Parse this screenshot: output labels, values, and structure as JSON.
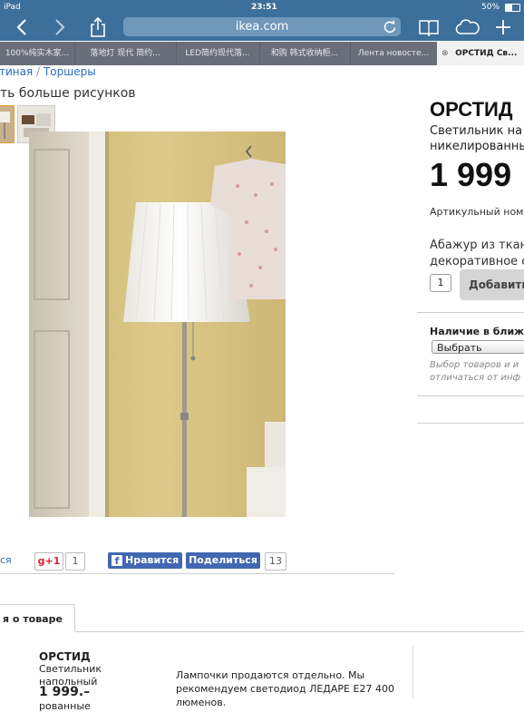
{
  "status_bar": {
    "device": "iPad",
    "time": "23:51",
    "battery": "50%"
  },
  "browser": {
    "url": "ikea.com"
  },
  "tabs": [
    {
      "label": "100%纯实木家..."
    },
    {
      "label": "落地灯 现代 简约..."
    },
    {
      "label": "LED简约现代落..."
    },
    {
      "label": "和购 韩式收纳柜..."
    },
    {
      "label": "Лента новосте..."
    },
    {
      "label": "ОРСТИД Св..."
    }
  ],
  "breadcrumb": {
    "part1": "тиная",
    "separator": "/",
    "part2": "Торшеры"
  },
  "gallery": {
    "more_images": "ть больше рисунков"
  },
  "social": {
    "left_link": "ся",
    "gplus_label": "g+1",
    "gplus_count": "1",
    "like_label": "Нравится",
    "share_label": "Поделиться",
    "share_count": "13"
  },
  "product": {
    "name": "ОРСТИД",
    "desc_line1": "Светильник на",
    "desc_line2": "никелированны",
    "price": "1 999",
    "article_label": "Артикульный номе",
    "shade_line1": "Абажур из ткан",
    "shade_line2": "декоративное с",
    "quantity": "1",
    "add_button": "Добавить"
  },
  "availability": {
    "title": "Наличие в ближа",
    "select_value": "Выбрать",
    "note_line1": "Выбор товаров и и",
    "note_line2": "отличаться от инф"
  },
  "info_tab": {
    "label": "я о товаре"
  },
  "bottom": {
    "name": "ОРСТИД",
    "desc_line1": "Светильник",
    "desc_line2": "напольный",
    "price": "1 999.–",
    "cut_text": "рованные",
    "note_line1": "Лампочки продаются отдельно. Мы",
    "note_line2": "рекомендуем светодиод ЛЕДАРЕ Е27 400",
    "note_line3": "люменов."
  },
  "colors": {
    "toolbar": "#3c6f9a",
    "tabbar": "#6a6e78",
    "link": "#2a6ebb",
    "facebook": "#4267b2"
  },
  "icons": [
    "back-icon",
    "forward-icon",
    "share-icon",
    "reload-icon",
    "reading-list-icon",
    "cloud-tabs-icon",
    "new-tab-icon",
    "close-tab-icon",
    "facebook-icon",
    "chevron-down-icon"
  ]
}
